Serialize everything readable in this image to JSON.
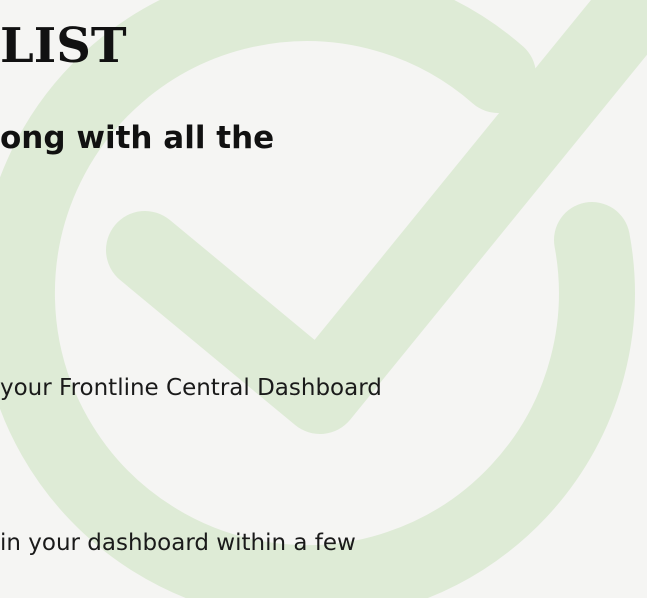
{
  "watermark": {
    "icon": "checkmark-circle-icon",
    "color": "#deebd6"
  },
  "document": {
    "heading_partial": "LIST",
    "subheading_partial": "ong with all the",
    "body_lines": [
      "your Frontline Central Dashboard",
      " in your dashboard within a few"
    ]
  }
}
